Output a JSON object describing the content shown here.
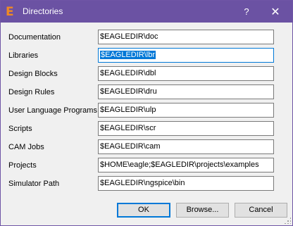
{
  "window": {
    "title": "Directories",
    "logo_letter": "E",
    "help_label": "?",
    "close_label": "✕",
    "accent_color": "#6b52a3",
    "logo_color": "#f08a24"
  },
  "rows": [
    {
      "label": "Documentation",
      "value": "$EAGLEDIR\\doc"
    },
    {
      "label": "Libraries",
      "value": "$EAGLEDIR\\lbr"
    },
    {
      "label": "Design Blocks",
      "value": "$EAGLEDIR\\dbl"
    },
    {
      "label": "Design Rules",
      "value": "$EAGLEDIR\\dru"
    },
    {
      "label": "User Language Programs",
      "value": "$EAGLEDIR\\ulp"
    },
    {
      "label": "Scripts",
      "value": "$EAGLEDIR\\scr"
    },
    {
      "label": "CAM Jobs",
      "value": "$EAGLEDIR\\cam"
    },
    {
      "label": "Projects",
      "value": "$HOME\\eagle;$EAGLEDIR\\projects\\examples"
    },
    {
      "label": "Simulator Path",
      "value": "$EAGLEDIR\\ngspice\\bin"
    }
  ],
  "buttons": {
    "ok": "OK",
    "browse": "Browse...",
    "cancel": "Cancel"
  }
}
